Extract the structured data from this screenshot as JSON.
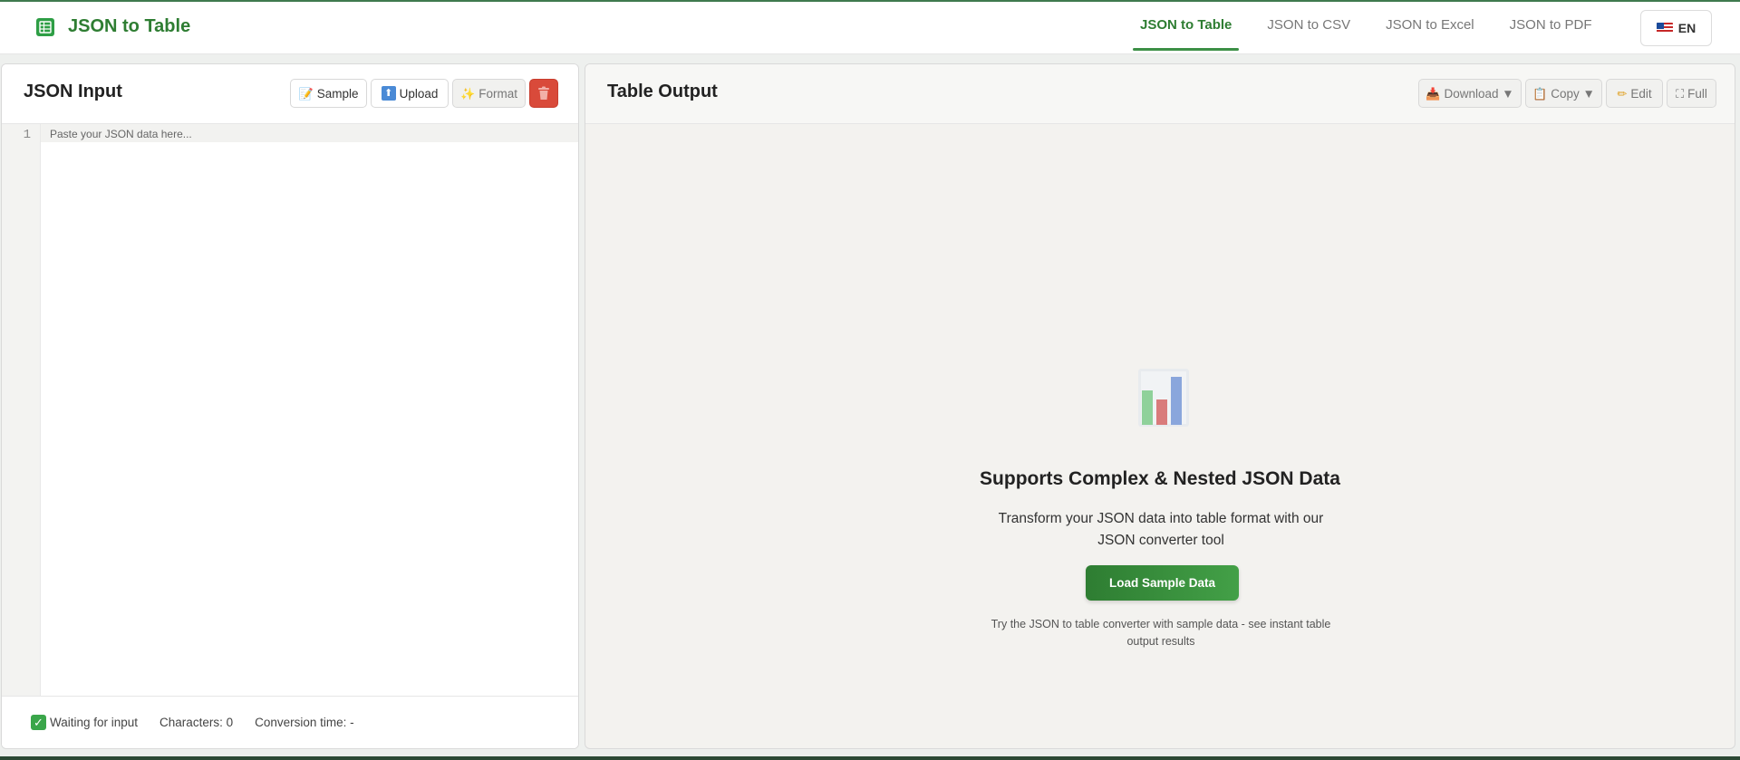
{
  "header": {
    "brand_title": "JSON to Table",
    "nav": [
      {
        "label": "JSON to Table",
        "active": true
      },
      {
        "label": "JSON to CSV",
        "active": false
      },
      {
        "label": "JSON to Excel",
        "active": false
      },
      {
        "label": "JSON to PDF",
        "active": false
      }
    ],
    "language": "EN"
  },
  "input_panel": {
    "title": "JSON Input",
    "buttons": {
      "sample": "Sample",
      "upload": "Upload",
      "format": "Format"
    },
    "editor": {
      "line_number": "1",
      "placeholder": "Paste your JSON data here..."
    },
    "status": {
      "state": "Waiting for input",
      "characters": "Characters: 0",
      "conversion_time": "Conversion time: -"
    }
  },
  "output_panel": {
    "title": "Table Output",
    "buttons": {
      "download": "Download ▼",
      "copy": "Copy ▼",
      "edit": "Edit",
      "full": "Full"
    },
    "empty_state": {
      "title": "Supports Complex & Nested JSON Data",
      "description": "Transform your JSON data into table format with our JSON converter tool",
      "load_button": "Load Sample Data",
      "hint": "Try the JSON to table converter with sample data - see instant table output results"
    }
  },
  "colors": {
    "brand": "#2e7d32",
    "accent": "#43a047",
    "danger": "#d94a3a",
    "active_nav": "#3c8f46"
  }
}
